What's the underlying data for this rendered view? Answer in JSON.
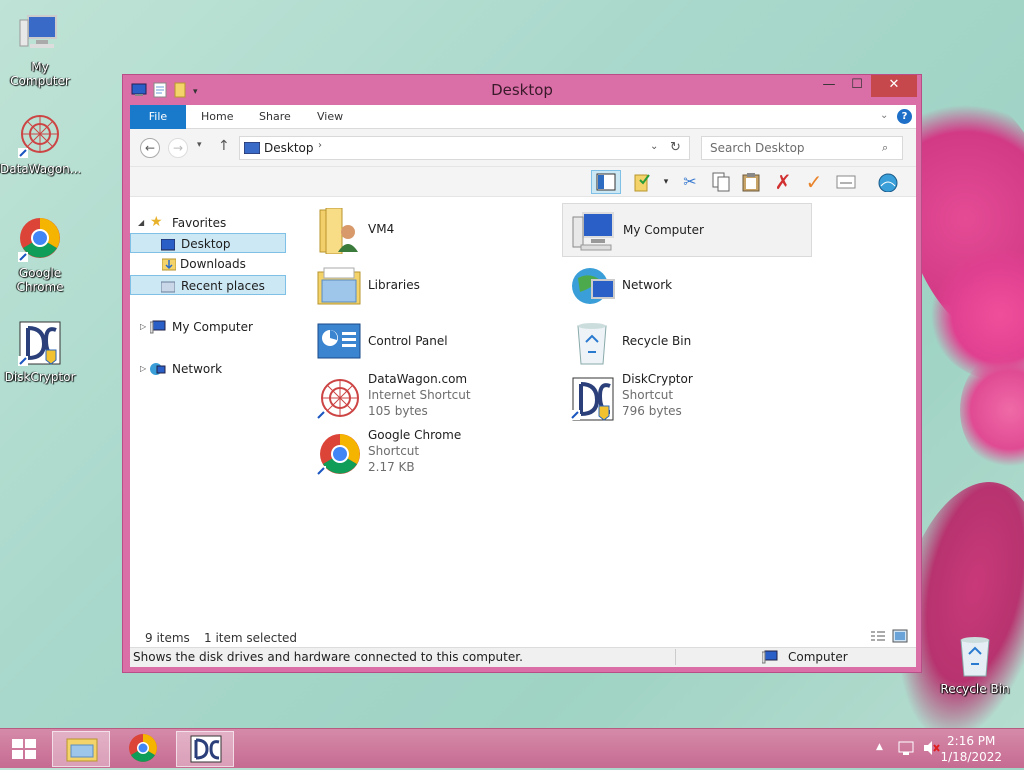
{
  "desktop": {
    "icons": [
      {
        "label": "My Computer"
      },
      {
        "label": "DataWagon..."
      },
      {
        "label": "Google Chrome"
      },
      {
        "label": "DiskCryptor"
      },
      {
        "label": "Recycle Bin"
      }
    ]
  },
  "window": {
    "title": "Desktop",
    "controls": {
      "minimize": "—",
      "maximize": "☐",
      "close": "✕"
    },
    "tabs": [
      "File",
      "Home",
      "Share",
      "View"
    ],
    "address": {
      "path": "Desktop"
    },
    "search": {
      "placeholder": "Search Desktop"
    },
    "nav": {
      "favorites": "Favorites",
      "desktop": "Desktop",
      "downloads": "Downloads",
      "recent": "Recent places",
      "computer": "My Computer",
      "network": "Network"
    },
    "files": [
      {
        "name": "VM4"
      },
      {
        "name": "My Computer"
      },
      {
        "name": "Libraries"
      },
      {
        "name": "Network"
      },
      {
        "name": "Control Panel"
      },
      {
        "name": "Recycle Bin"
      },
      {
        "name": "DataWagon.com",
        "type": "Internet Shortcut",
        "size": "105 bytes"
      },
      {
        "name": "DiskCryptor",
        "type": "Shortcut",
        "size": "796 bytes"
      },
      {
        "name": "Google Chrome",
        "type": "Shortcut",
        "size": "2.17 KB"
      }
    ],
    "status": {
      "count": "9 items",
      "selected": "1 item selected"
    },
    "infobar": {
      "text": "Shows the disk drives and hardware connected to this computer.",
      "location": "Computer"
    }
  },
  "taskbar": {
    "time": "2:16 PM",
    "date": "1/18/2022"
  }
}
